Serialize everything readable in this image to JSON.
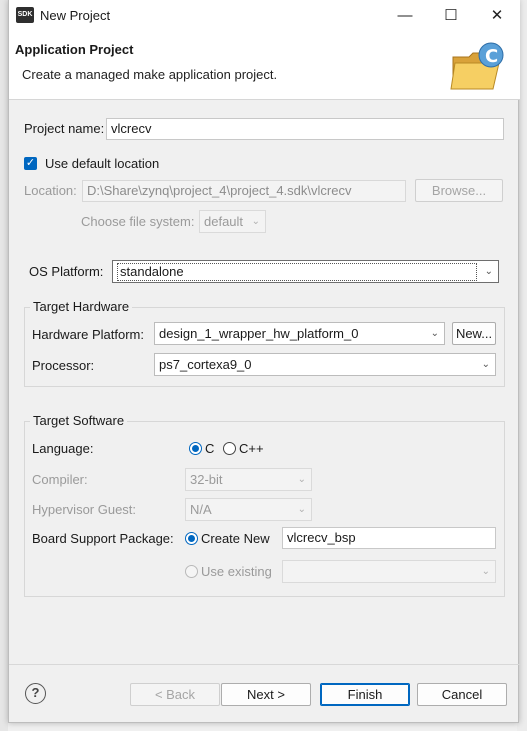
{
  "window": {
    "title": "New Project",
    "icon_text": "SDK",
    "controls": {
      "minimize": "—",
      "maximize": "☐",
      "close": "✕"
    }
  },
  "header": {
    "title": "Application Project",
    "subtitle": "Create a managed make application project."
  },
  "project": {
    "name_label": "Project name:",
    "name_value": "vlcrecv",
    "use_default_label": "Use default location",
    "use_default_checked": true,
    "location_label": "Location:",
    "location_value": "D:\\Share\\zynq\\project_4\\project_4.sdk\\vlcrecv",
    "browse_label": "Browse...",
    "file_system_label": "Choose file system:",
    "file_system_value": "default"
  },
  "os_platform": {
    "label": "OS Platform:",
    "value": "standalone"
  },
  "target_hardware": {
    "title": "Target Hardware",
    "hw_platform_label": "Hardware Platform:",
    "hw_platform_value": "design_1_wrapper_hw_platform_0",
    "new_button": "New...",
    "processor_label": "Processor:",
    "processor_value": "ps7_cortexa9_0"
  },
  "target_software": {
    "title": "Target Software",
    "language_label": "Language:",
    "lang_c": "C",
    "lang_cpp": "C++",
    "selected_language": "C",
    "compiler_label": "Compiler:",
    "compiler_value": "32-bit",
    "hypervisor_label": "Hypervisor Guest:",
    "hypervisor_value": "N/A",
    "bsp_label": "Board Support Package:",
    "create_new_label": "Create New",
    "create_new_value": "vlcrecv_bsp",
    "use_existing_label": "Use existing",
    "use_existing_value": ""
  },
  "footer": {
    "help": "?",
    "back": "< Back",
    "next": "Next >",
    "finish": "Finish",
    "cancel": "Cancel"
  },
  "colors": {
    "accent": "#0067c0",
    "background": "#f0f0f0"
  }
}
